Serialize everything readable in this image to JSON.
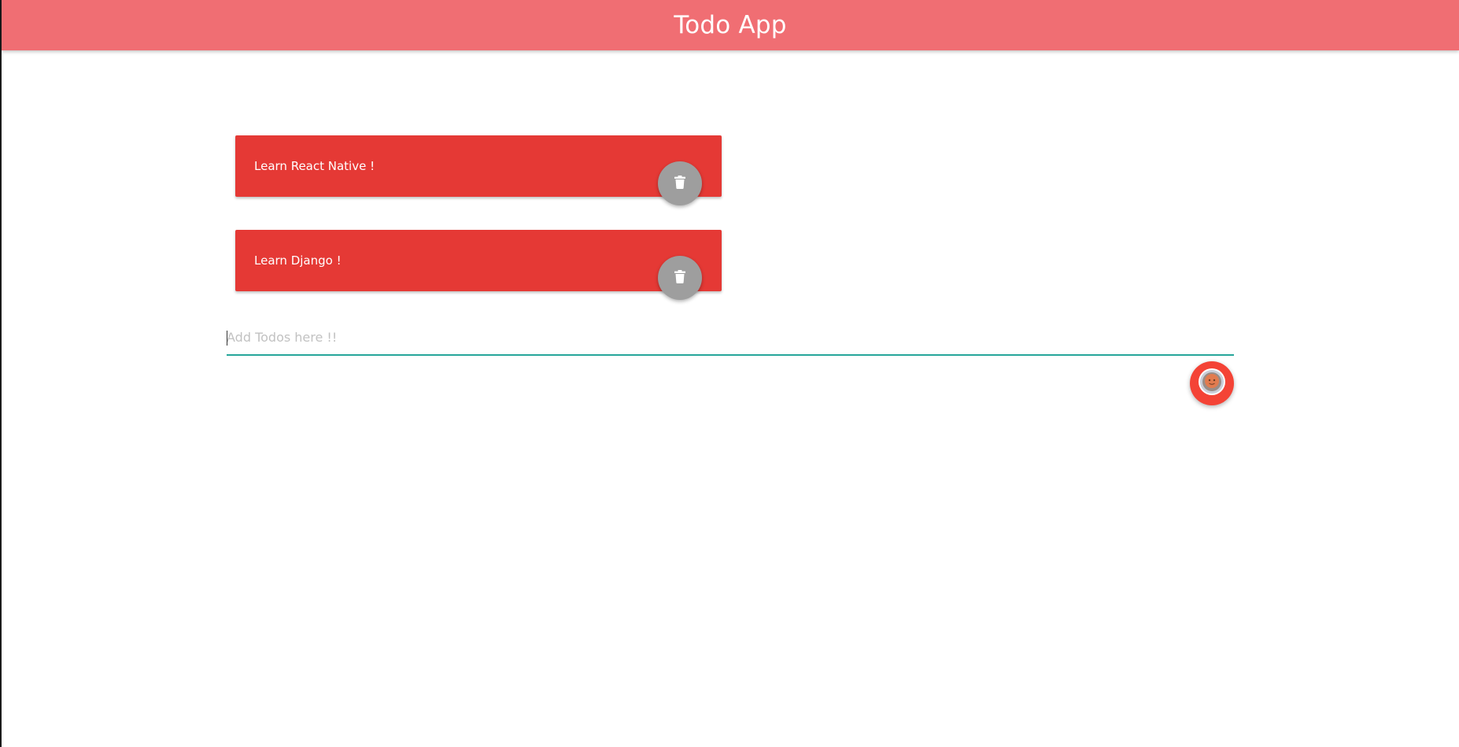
{
  "app_bar": {
    "title": "Todo App"
  },
  "todos": [
    {
      "text": "Learn React Native !",
      "delete_icon": "trash-icon"
    },
    {
      "text": "Learn Django !",
      "delete_icon": "trash-icon"
    }
  ],
  "add_todo": {
    "value": "",
    "placeholder": "Add Todos here !!",
    "submit_icon": "avatar-icon"
  },
  "colors": {
    "app_bar": "#f06e73",
    "todo_card": "#e53935",
    "delete_button": "#9e9e9e",
    "input_underline": "#26a69a",
    "fab": "#f44336"
  }
}
